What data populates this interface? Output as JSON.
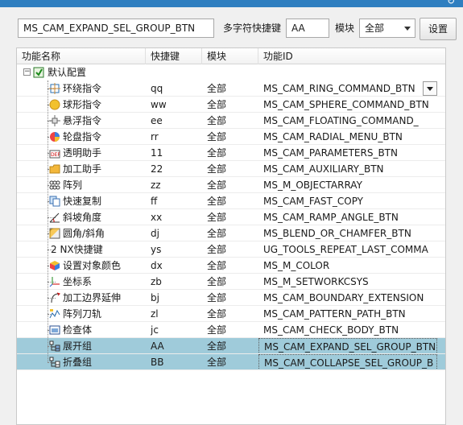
{
  "title_bar": {
    "refresh_icon": "refresh-icon"
  },
  "toolbar": {
    "search_value": "MS_CAM_EXPAND_SEL_GROUP_BTN",
    "shortcut_label": "多字符快捷键",
    "shortcut_value": "AA",
    "module_label": "模块",
    "module_value": "全部",
    "settings_label": "设置"
  },
  "table": {
    "headers": [
      "功能名称",
      "快捷键",
      "模块",
      "功能ID"
    ],
    "root_label": "默认配置",
    "rows": [
      {
        "name": "环绕指令",
        "key": "qq",
        "module": "全部",
        "id": "MS_CAM_RING_COMMAND_BTN",
        "icon": "ring-command-icon"
      },
      {
        "name": "球形指令",
        "key": "ww",
        "module": "全部",
        "id": "MS_CAM_SPHERE_COMMAND_BTN",
        "icon": "sphere-icon"
      },
      {
        "name": "悬浮指令",
        "key": "ee",
        "module": "全部",
        "id": "MS_CAM_FLOATING_COMMAND_",
        "icon": "floating-icon"
      },
      {
        "name": "轮盘指令",
        "key": "rr",
        "module": "全部",
        "id": "MS_CAM_RADIAL_MENU_BTN",
        "icon": "radial-menu-icon"
      },
      {
        "name": "透明助手",
        "key": "11",
        "module": "全部",
        "id": "MS_CAM_PARAMETERS_BTN",
        "icon": "parameters-icon"
      },
      {
        "name": "加工助手",
        "key": "22",
        "module": "全部",
        "id": "MS_CAM_AUXILIARY_BTN",
        "icon": "folder-icon"
      },
      {
        "name": "阵列",
        "key": "zz",
        "module": "全部",
        "id": "MS_M_OBJECTARRAY",
        "icon": "array-icon"
      },
      {
        "name": "快速复制",
        "key": "ff",
        "module": "全部",
        "id": "MS_CAM_FAST_COPY",
        "icon": "copy-icon"
      },
      {
        "name": "斜坡角度",
        "key": "xx",
        "module": "全部",
        "id": "MS_CAM_RAMP_ANGLE_BTN",
        "icon": "angle-icon"
      },
      {
        "name": "圆角/斜角",
        "key": "dj",
        "module": "全部",
        "id": "MS_BLEND_OR_CHAMFER_BTN",
        "icon": "blend-icon"
      },
      {
        "name": "2 NX快捷键",
        "key": "ys",
        "module": "全部",
        "id": "UG_TOOLS_REPEAT_LAST_COMMA",
        "icon": ""
      },
      {
        "name": "设置对象颜色",
        "key": "dx",
        "module": "全部",
        "id": "MS_M_COLOR",
        "icon": "color-cube-icon"
      },
      {
        "name": "坐标系",
        "key": "zb",
        "module": "全部",
        "id": "MS_M_SETWORKCSYS",
        "icon": "csys-icon"
      },
      {
        "name": "加工边界延伸",
        "key": "bj",
        "module": "全部",
        "id": "MS_CAM_BOUNDARY_EXTENSION",
        "icon": "boundary-icon"
      },
      {
        "name": "阵列刀轨",
        "key": "zl",
        "module": "全部",
        "id": "MS_CAM_PATTERN_PATH_BTN",
        "icon": "pattern-path-icon"
      },
      {
        "name": "检查体",
        "key": "jc",
        "module": "全部",
        "id": "MS_CAM_CHECK_BODY_BTN",
        "icon": "check-body-icon"
      },
      {
        "name": "展开组",
        "key": "AA",
        "module": "全部",
        "id": "MS_CAM_EXPAND_SEL_GROUP_BTN",
        "icon": "expand-group-icon"
      },
      {
        "name": "折叠组",
        "key": "BB",
        "module": "全部",
        "id": "MS_CAM_COLLAPSE_SEL_GROUP_B",
        "icon": "collapse-group-icon"
      }
    ]
  },
  "colors": {
    "selection": "#9fcbda",
    "title_bar": "#2f7fc0"
  }
}
